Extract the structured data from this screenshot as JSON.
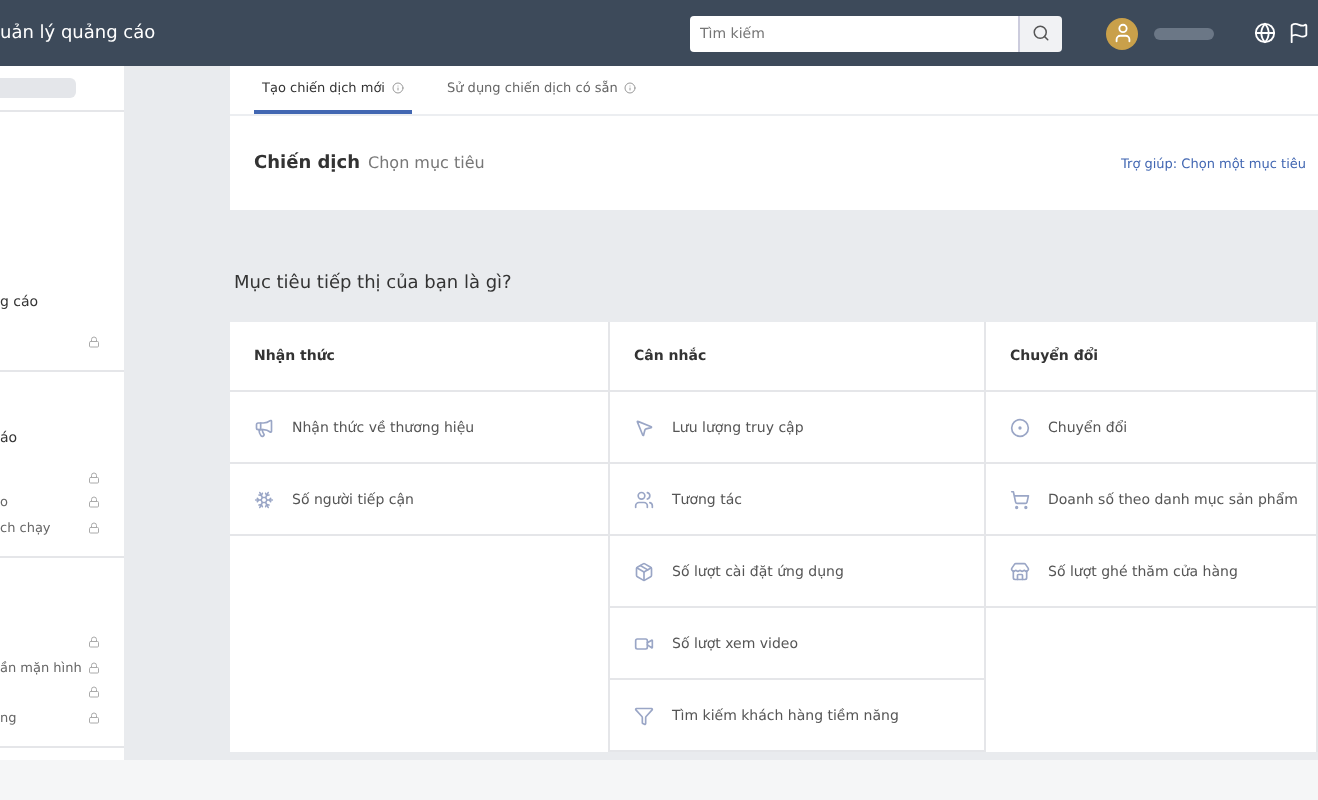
{
  "topbar": {
    "title": "uản lý quảng cáo",
    "search": {
      "placeholder": "Tìm kiếm"
    }
  },
  "sidebar": {
    "sections": [
      {
        "title": "g cáo",
        "rows": [
          ""
        ]
      },
      {
        "title": "áo",
        "rows": [
          "",
          "o",
          "ch chạy"
        ]
      },
      {
        "rows": [
          "",
          "ần mặn hình",
          "",
          "ng"
        ]
      }
    ]
  },
  "campaign_card": {
    "tabs": [
      {
        "label": "Tạo chiến dịch mới",
        "selected": true
      },
      {
        "label": "Sử dụng chiến dịch có sẵn",
        "selected": false
      }
    ],
    "heading": "Chiến dịch",
    "subheading": "Chọn mục tiêu",
    "help_link": "Trợ giúp: Chọn một mục tiêu"
  },
  "objectives": {
    "question": "Mục tiêu tiếp thị của bạn là gì?",
    "columns": [
      {
        "title": "Nhận thức",
        "items": [
          "Nhận thức về thương hiệu",
          "Số người tiếp cận"
        ]
      },
      {
        "title": "Cân nhắc",
        "items": [
          "Lưu lượng truy cập",
          "Tương tác",
          "Số lượt cài đặt ứng dụng",
          "Số lượt xem video",
          "Tìm kiếm khách hàng tiềm năng"
        ]
      },
      {
        "title": "Chuyển đổi",
        "items": [
          "Chuyển đổi",
          "Doanh số theo danh mục sản phẩm",
          "Số lượt ghé thăm cửa hàng"
        ]
      }
    ]
  }
}
